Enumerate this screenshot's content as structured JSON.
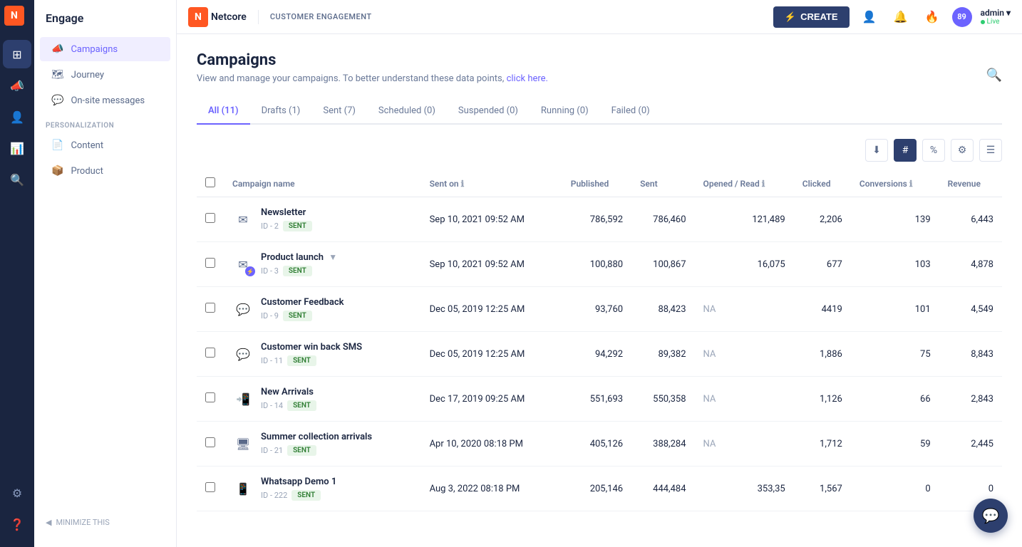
{
  "topbar": {
    "logo_letter": "N",
    "app_name": "Netcore",
    "section_label": "CUSTOMER ENGAGEMENT",
    "create_btn": "CREATE",
    "admin_name": "admin ▾",
    "admin_status": "Live",
    "notification_count": "89"
  },
  "sidebar": {
    "title": "Engage",
    "items": [
      {
        "id": "campaigns",
        "label": "Campaigns",
        "icon": "📣",
        "active": true
      },
      {
        "id": "journey",
        "label": "Journey",
        "icon": "🗺"
      },
      {
        "id": "on-site-messages",
        "label": "On-site messages",
        "icon": "💬"
      }
    ],
    "personalization_section": "PERSONALIZATION",
    "personalization_items": [
      {
        "id": "content",
        "label": "Content",
        "icon": "📄"
      },
      {
        "id": "product",
        "label": "Product",
        "icon": "📦"
      }
    ],
    "minimize_label": "MINIMIZE THIS"
  },
  "page": {
    "title": "Campaigns",
    "subtitle": "View and manage your campaigns. To better understand these data points,",
    "subtitle_link": "click here.",
    "subtitle_link_url": "#"
  },
  "tabs": [
    {
      "label": "All (11)",
      "active": true
    },
    {
      "label": "Drafts (1)",
      "active": false
    },
    {
      "label": "Sent (7)",
      "active": false
    },
    {
      "label": "Scheduled (0)",
      "active": false
    },
    {
      "label": "Suspended (0)",
      "active": false
    },
    {
      "label": "Running (0)",
      "active": false
    },
    {
      "label": "Failed (0)",
      "active": false
    }
  ],
  "table": {
    "columns": [
      {
        "key": "name",
        "label": "Campaign name"
      },
      {
        "key": "sent_on",
        "label": "Sent on"
      },
      {
        "key": "published",
        "label": "Published"
      },
      {
        "key": "sent",
        "label": "Sent"
      },
      {
        "key": "opened_read",
        "label": "Opened / Read"
      },
      {
        "key": "clicked",
        "label": "Clicked"
      },
      {
        "key": "conversions",
        "label": "Conversions"
      },
      {
        "key": "revenue",
        "label": "Revenue"
      }
    ],
    "rows": [
      {
        "name": "Newsletter",
        "id": "ID - 2",
        "status": "SENT",
        "icon": "email",
        "has_lightning": false,
        "has_expand": false,
        "sent_on": "Sep 10, 2021 09:52 AM",
        "published": "786,592",
        "sent": "786,460",
        "opened_read": "121,489",
        "clicked": "2,206",
        "conversions": "139",
        "revenue": "6,443"
      },
      {
        "name": "Product launch",
        "id": "ID - 3",
        "status": "SENT",
        "icon": "email",
        "has_lightning": true,
        "has_expand": true,
        "sent_on": "Sep 10, 2021 09:52 AM",
        "published": "100,880",
        "sent": "100,867",
        "opened_read": "16,075",
        "clicked": "677",
        "conversions": "103",
        "revenue": "4,878"
      },
      {
        "name": "Customer Feedback",
        "id": "ID - 9",
        "status": "SENT",
        "icon": "sms",
        "has_lightning": false,
        "has_expand": false,
        "sent_on": "Dec 05, 2019 12:25 AM",
        "published": "93,760",
        "sent": "88,423",
        "opened_read": "NA",
        "clicked": "4419",
        "conversions": "101",
        "revenue": "4,549"
      },
      {
        "name": "Customer win back SMS",
        "id": "ID - 11",
        "status": "SENT",
        "icon": "sms",
        "has_lightning": false,
        "has_expand": false,
        "sent_on": "Dec 05, 2019 12:25 AM",
        "published": "94,292",
        "sent": "89,382",
        "opened_read": "NA",
        "clicked": "1,886",
        "conversions": "75",
        "revenue": "8,843"
      },
      {
        "name": "New Arrivals",
        "id": "ID - 14",
        "status": "SENT",
        "icon": "push",
        "has_lightning": false,
        "has_expand": false,
        "sent_on": "Dec 17, 2019 09:25 AM",
        "published": "551,693",
        "sent": "550,358",
        "opened_read": "NA",
        "clicked": "1,126",
        "conversions": "66",
        "revenue": "2,843"
      },
      {
        "name": "Summer collection arrivals",
        "id": "ID - 21",
        "status": "SENT",
        "icon": "display",
        "has_lightning": false,
        "has_expand": false,
        "sent_on": "Apr 10, 2020 08:18 PM",
        "published": "405,126",
        "sent": "388,284",
        "opened_read": "NA",
        "clicked": "1,712",
        "conversions": "59",
        "revenue": "2,445"
      },
      {
        "name": "Whatsapp Demo 1",
        "id": "ID - 222",
        "status": "SENT",
        "icon": "whatsapp",
        "has_lightning": false,
        "has_expand": false,
        "sent_on": "Aug 3, 2022 08:18 PM",
        "published": "205,146",
        "sent": "444,484",
        "opened_read": "353,35",
        "clicked": "1,567",
        "conversions": "0",
        "revenue": "0"
      }
    ]
  },
  "toolbar": {
    "download_icon": "⬇",
    "hash_icon": "#",
    "percent_icon": "%",
    "settings_icon": "⚙",
    "filter_icon": "☰"
  },
  "chat_button": {
    "icon": "💬"
  },
  "minimize_label": "MINIMIZE THIS"
}
